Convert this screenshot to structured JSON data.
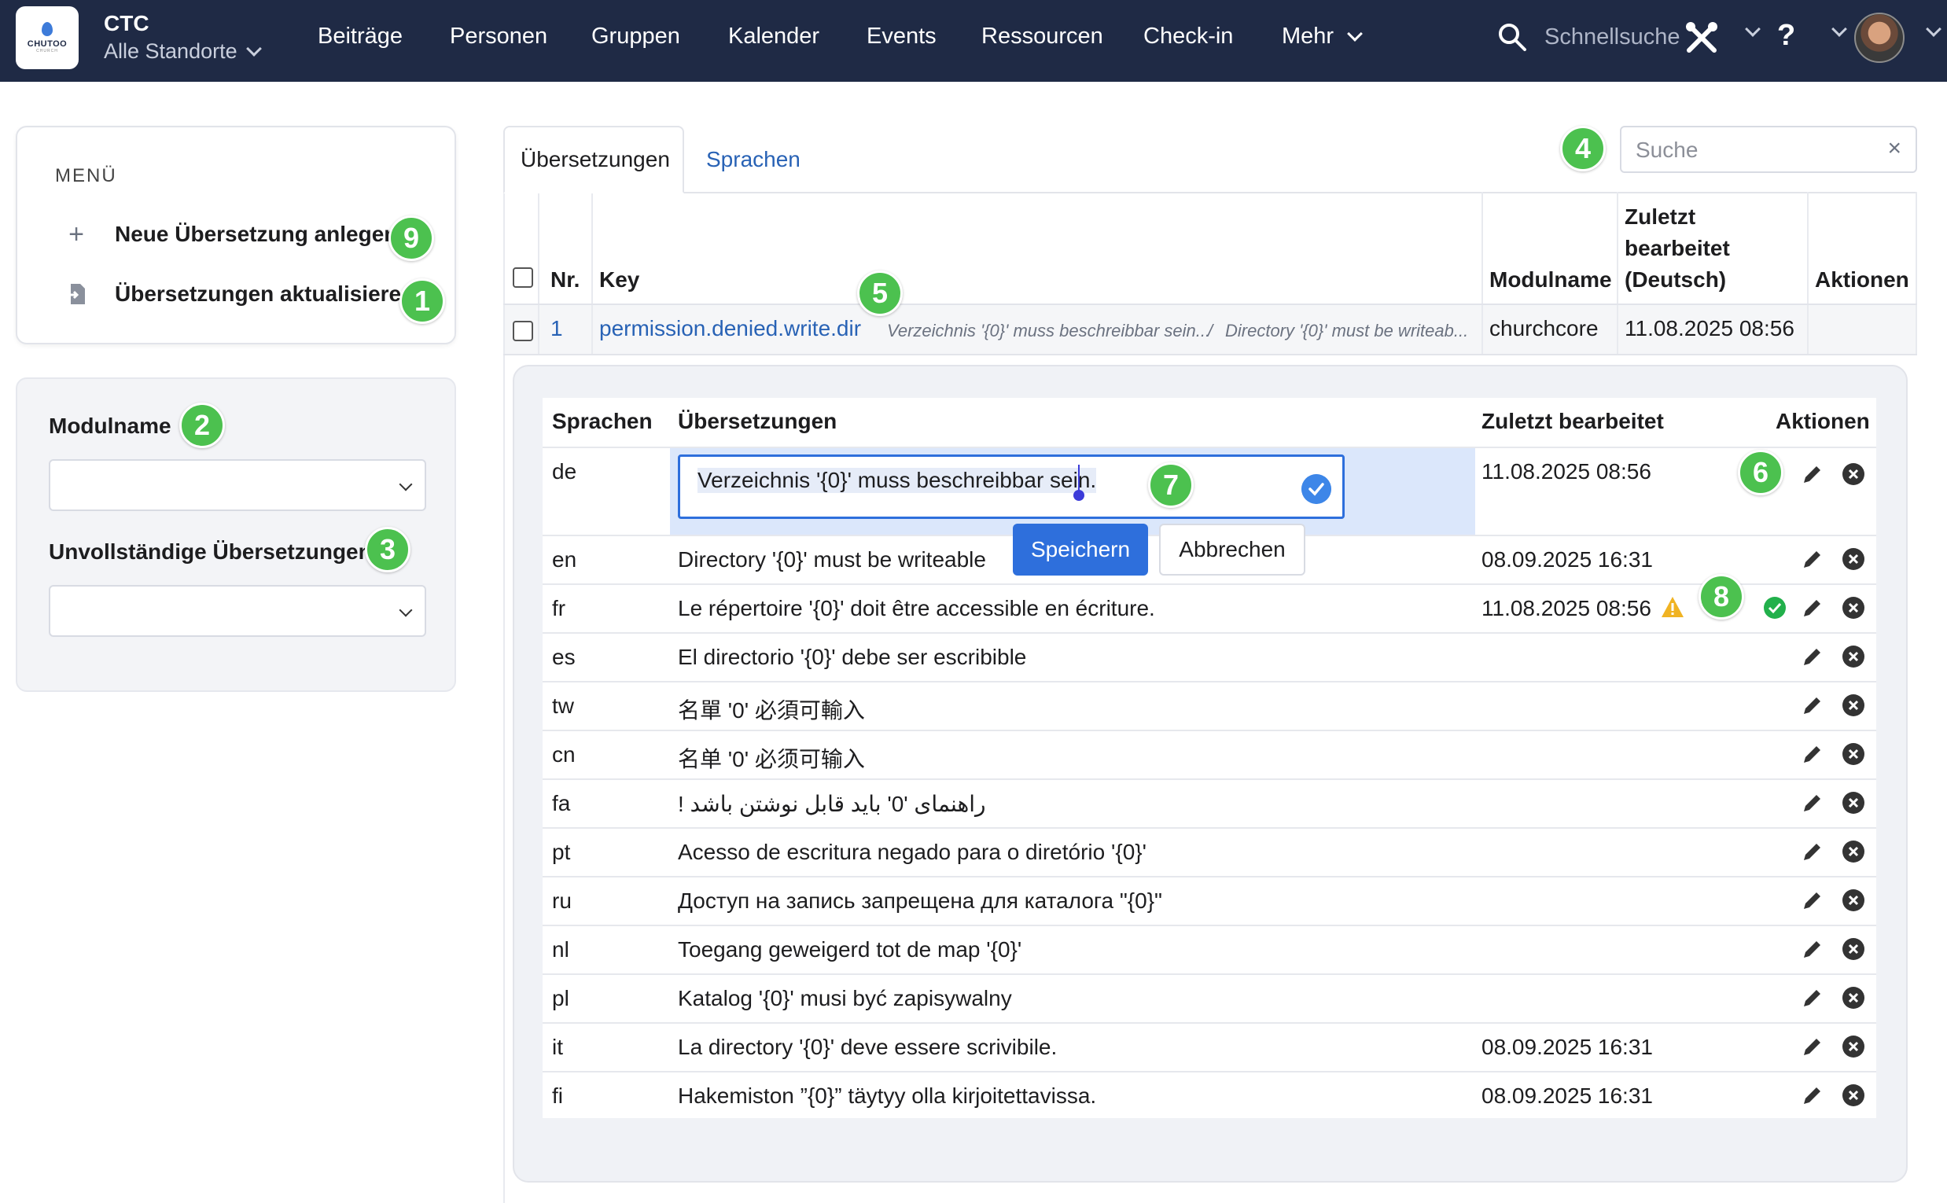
{
  "app": {
    "logo_text": "CHUTOO",
    "logo_sub": "CHURCH",
    "org_title": "CTC",
    "org_location": "Alle Standorte"
  },
  "nav": {
    "items": [
      "Beiträge",
      "Personen",
      "Gruppen",
      "Kalender",
      "Events",
      "Ressourcen",
      "Check-in",
      "Mehr"
    ],
    "search_label": "Schnellsuche",
    "help": "?"
  },
  "menu": {
    "heading": "MENÜ",
    "new_translation": "Neue Übersetzung anlegen",
    "update_translations": "Übersetzungen aktualisieren"
  },
  "filters": {
    "module_label": "Modulname",
    "module_value": "",
    "incomplete_label": "Unvollständige Übersetzungen",
    "incomplete_value": ""
  },
  "tabs": {
    "translations": "Übersetzungen",
    "languages": "Sprachen"
  },
  "search": {
    "placeholder": "Suche",
    "value": ""
  },
  "badges": [
    "9",
    "1",
    "2",
    "3",
    "4",
    "5",
    "6",
    "7",
    "8"
  ],
  "table": {
    "headers": {
      "nr": "Nr.",
      "key": "Key",
      "module": "Modulname",
      "edited_1": "Zuletzt",
      "edited_2": "bearbeitet",
      "edited_3": "(Deutsch)",
      "actions": "Aktionen"
    },
    "row": {
      "nr": "1",
      "key": "permission.denied.write.dir",
      "preview_de": "Verzeichnis '{0}' muss beschreibbar sein...",
      "preview_sep": "/",
      "preview_en": "Directory '{0}' must be writeab...",
      "module": "churchcore",
      "edited": "11.08.2025 08:56"
    }
  },
  "detail": {
    "headers": {
      "languages": "Sprachen",
      "translations": "Übersetzungen",
      "edited": "Zuletzt bearbeitet",
      "actions": "Aktionen"
    },
    "editing_value": "Verzeichnis '{0}' muss beschreibbar sein.",
    "save_label": "Speichern",
    "cancel_label": "Abbrechen",
    "rows": [
      {
        "lang": "de",
        "text": "",
        "edited": "11.08.2025 08:56"
      },
      {
        "lang": "en",
        "text": "Directory '{0}' must be writeable",
        "edited": "08.09.2025 16:31"
      },
      {
        "lang": "fr",
        "text": "Le répertoire '{0}' doit être accessible en écriture.",
        "edited": "11.08.2025 08:56"
      },
      {
        "lang": "es",
        "text": "El directorio '{0}' debe ser escribible",
        "edited": ""
      },
      {
        "lang": "tw",
        "text": "名單 '0' 必須可輸入",
        "edited": ""
      },
      {
        "lang": "cn",
        "text": "名单 '0' 必须可输入",
        "edited": ""
      },
      {
        "lang": "fa",
        "text": "راهنمای '0' باید قابل نوشتن باشد !",
        "edited": ""
      },
      {
        "lang": "pt",
        "text": "Acesso de escritura negado para o diretório '{0}'",
        "edited": ""
      },
      {
        "lang": "ru",
        "text": "Доступ на запись запрещена для каталога \"{0}\"",
        "edited": ""
      },
      {
        "lang": "nl",
        "text": "Toegang geweigerd tot de map '{0}'",
        "edited": ""
      },
      {
        "lang": "pl",
        "text": "Katalog '{0}' musi być zapisywalny",
        "edited": ""
      },
      {
        "lang": "it",
        "text": "La directory '{0}' deve essere scrivibile.",
        "edited": "08.09.2025 16:31"
      },
      {
        "lang": "fi",
        "text": "Hakemiston ”{0}” täytyy olla kirjoitettavissa.",
        "edited": "08.09.2025 16:31"
      }
    ]
  },
  "colors": {
    "topbar": "#1f2a45",
    "primary": "#2e6fdc",
    "link": "#2862b5",
    "badge": "#4cc14f",
    "warning": "#f0b323",
    "success": "#22b04b"
  }
}
